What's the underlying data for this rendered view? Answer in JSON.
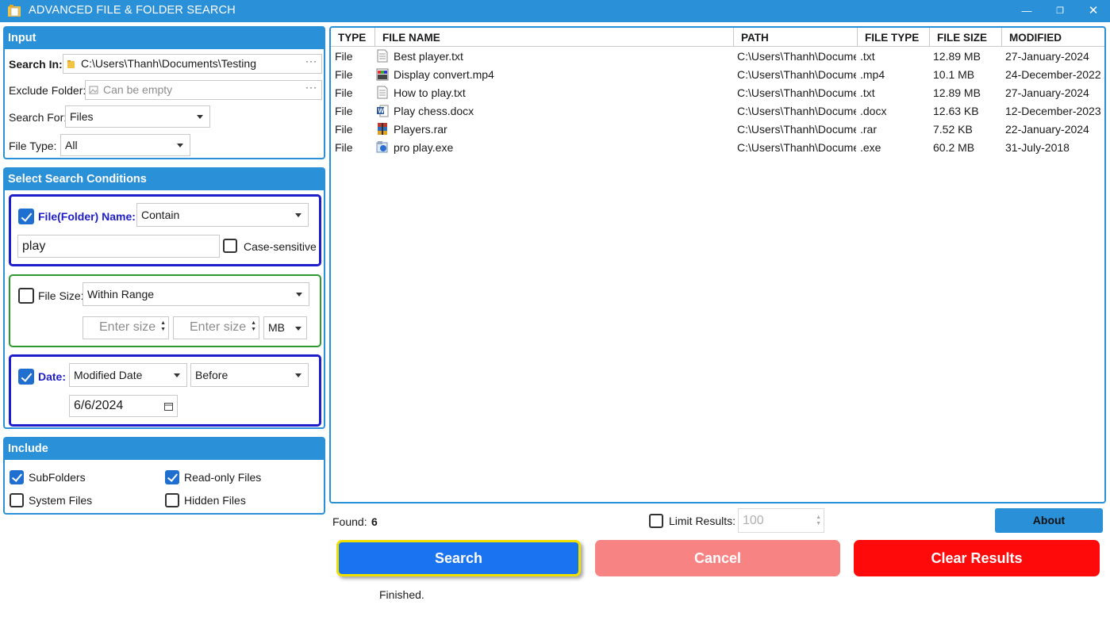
{
  "window": {
    "title": "ADVANCED FILE & FOLDER SEARCH",
    "minimize_glyph": "—",
    "maximize_glyph": "❐",
    "close_glyph": "✕"
  },
  "input_panel": {
    "header": "Input",
    "search_in_label": "Search In:",
    "search_in_value": "C:\\Users\\Thanh\\Documents\\Testing",
    "exclude_label": "Exclude Folder:",
    "exclude_placeholder": "Can be empty",
    "browse_dots": "···",
    "search_for_label": "Search For:",
    "search_for_value": "Files",
    "file_type_label": "File Type:",
    "file_type_value": "All"
  },
  "conditions_panel": {
    "header": "Select Search Conditions",
    "name": {
      "checked": true,
      "label": "File(Folder) Name:",
      "mode": "Contain",
      "text": "play",
      "case_sensitive_label": "Case-sensitive",
      "case_sensitive": false
    },
    "size": {
      "checked": false,
      "label": "File Size:",
      "mode": "Within Range",
      "min_placeholder": "Enter size",
      "max_placeholder": "Enter size",
      "unit": "MB"
    },
    "date": {
      "checked": true,
      "label": "Date:",
      "kind": "Modified Date",
      "relation": "Before",
      "value": "6/6/2024"
    }
  },
  "include_panel": {
    "header": "Include",
    "options": [
      {
        "label": "SubFolders",
        "checked": true
      },
      {
        "label": "Read-only Files",
        "checked": true
      },
      {
        "label": "System Files",
        "checked": false
      },
      {
        "label": "Hidden Files",
        "checked": false
      }
    ]
  },
  "results": {
    "columns": [
      "TYPE",
      "FILE NAME",
      "PATH",
      "FILE TYPE",
      "FILE SIZE",
      "MODIFIED"
    ],
    "rows": [
      {
        "type": "File",
        "name": "Best player.txt",
        "icon": "text-file-icon",
        "path": "C:\\Users\\Thanh\\Docume",
        "ext": ".txt",
        "size": "12.89 MB",
        "modified": "27-January-2024"
      },
      {
        "type": "File",
        "name": "Display convert.mp4",
        "icon": "video-file-icon",
        "path": "C:\\Users\\Thanh\\Docume",
        "ext": ".mp4",
        "size": "10.1 MB",
        "modified": "24-December-2022"
      },
      {
        "type": "File",
        "name": "How to play.txt",
        "icon": "text-file-icon",
        "path": "C:\\Users\\Thanh\\Docume",
        "ext": ".txt",
        "size": "12.89 MB",
        "modified": "27-January-2024"
      },
      {
        "type": "File",
        "name": "Play chess.docx",
        "icon": "word-file-icon",
        "path": "C:\\Users\\Thanh\\Docume",
        "ext": ".docx",
        "size": "12.63 KB",
        "modified": "12-December-2023"
      },
      {
        "type": "File",
        "name": "Players.rar",
        "icon": "archive-file-icon",
        "path": "C:\\Users\\Thanh\\Docume",
        "ext": ".rar",
        "size": "7.52 KB",
        "modified": "22-January-2024"
      },
      {
        "type": "File",
        "name": "pro play.exe",
        "icon": "exe-file-icon",
        "path": "C:\\Users\\Thanh\\Docume",
        "ext": ".exe",
        "size": "60.2 MB",
        "modified": "31-July-2018"
      }
    ]
  },
  "footer": {
    "found_label": "Found:",
    "found_count": "6",
    "limit_label": "Limit Results:",
    "limit_checked": false,
    "limit_value": "100",
    "about_label": "About",
    "search_label": "Search",
    "cancel_label": "Cancel",
    "clear_label": "Clear Results",
    "status": "Finished."
  },
  "colors": {
    "accent": "#2a90d8",
    "search_button": "#1a73f0",
    "search_border": "#f0e000",
    "cancel_button": "#f78383",
    "clear_button": "#ff0a0a"
  }
}
